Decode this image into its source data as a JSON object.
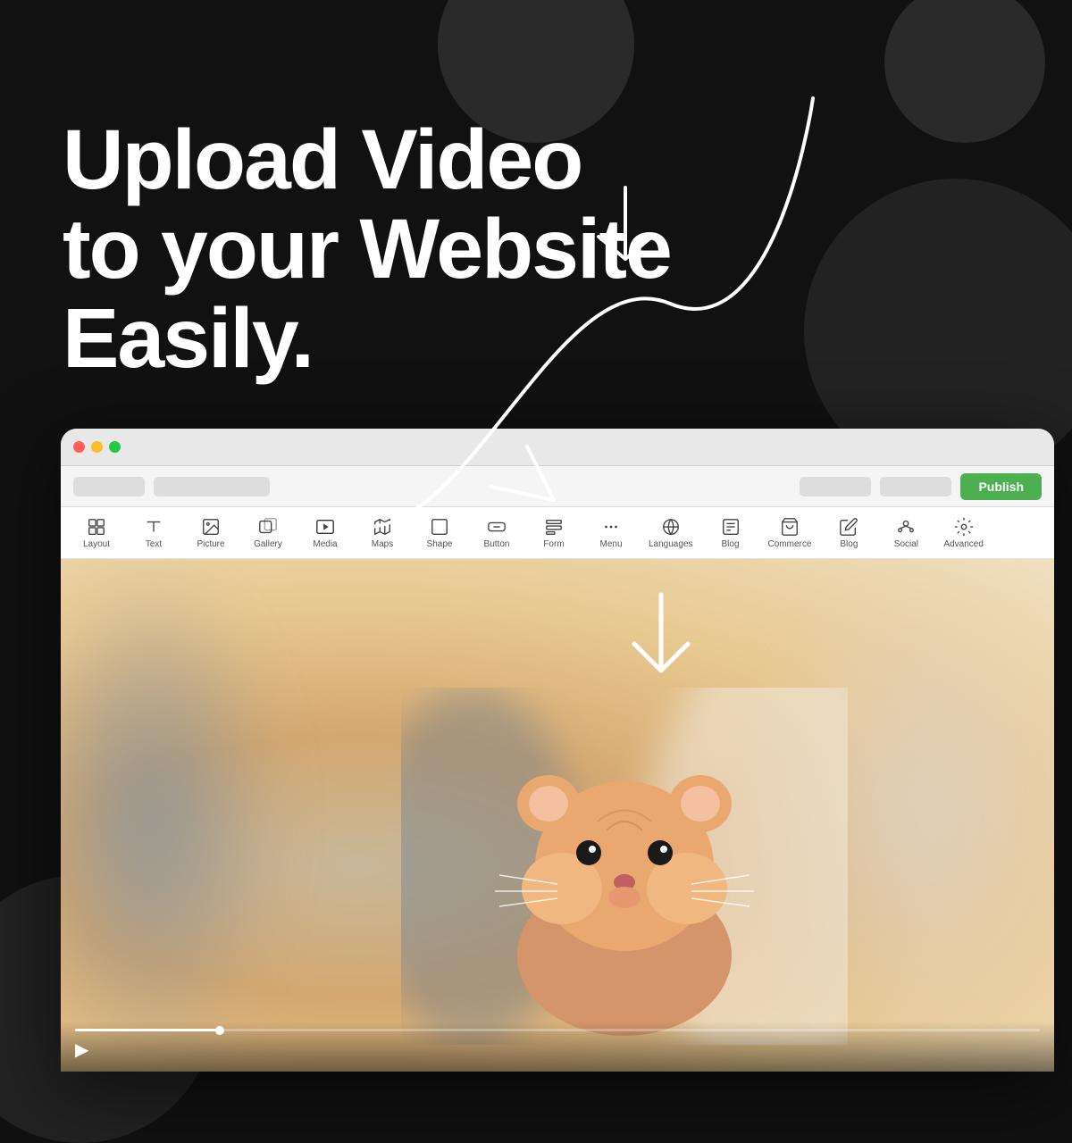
{
  "background": {
    "color": "#111111"
  },
  "hero": {
    "line1": "Upload Video",
    "line2": "to your Website",
    "line3": "Easily."
  },
  "browser": {
    "publish_button": "Publish",
    "toolbar_items": [
      {
        "id": "layout",
        "label": "Layout",
        "icon": "layout"
      },
      {
        "id": "text",
        "label": "Text",
        "icon": "text"
      },
      {
        "id": "picture",
        "label": "Picture",
        "icon": "picture"
      },
      {
        "id": "gallery",
        "label": "Gallery",
        "icon": "gallery"
      },
      {
        "id": "media",
        "label": "Media",
        "icon": "media"
      },
      {
        "id": "maps",
        "label": "Maps",
        "icon": "maps"
      },
      {
        "id": "shape",
        "label": "Shape",
        "icon": "shape"
      },
      {
        "id": "button",
        "label": "Button",
        "icon": "button"
      },
      {
        "id": "form",
        "label": "Form",
        "icon": "form"
      },
      {
        "id": "menu",
        "label": "Menu",
        "icon": "menu"
      },
      {
        "id": "languages",
        "label": "Languages",
        "icon": "languages"
      },
      {
        "id": "blog",
        "label": "Blog",
        "icon": "blog"
      },
      {
        "id": "commerce",
        "label": "Commerce",
        "icon": "commerce"
      },
      {
        "id": "blog2",
        "label": "Blog",
        "icon": "blog2"
      },
      {
        "id": "social",
        "label": "Social",
        "icon": "social"
      },
      {
        "id": "advanced",
        "label": "Advanced",
        "icon": "advanced"
      }
    ],
    "video": {
      "progress_percent": 15
    }
  },
  "colors": {
    "publish_green": "#4caf50",
    "background_dark": "#111111",
    "circle_dark": "#2a2a2a"
  }
}
